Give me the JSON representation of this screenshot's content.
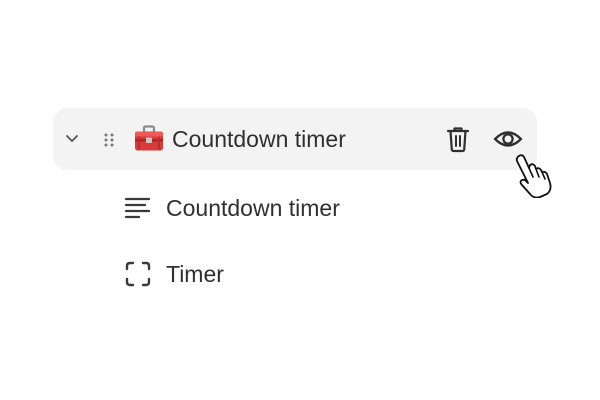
{
  "tree": {
    "parent": {
      "label": "Countdown timer",
      "icons": {
        "expand": "chevron-down-icon",
        "drag": "drag-handle-icon",
        "block": "toolbox-icon",
        "delete": "trash-icon",
        "visibility": "eye-icon"
      }
    },
    "children": [
      {
        "label": "Countdown timer",
        "icon": "text-align-left-icon"
      },
      {
        "label": "Timer",
        "icon": "dashed-frame-icon"
      }
    ]
  },
  "cursor": {
    "icon": "pointer-hand-icon"
  },
  "colors": {
    "row_highlight": "#f3f3f3",
    "text": "#303030",
    "icon": "#3a3a3a",
    "toolbox_red": "#d93a3a"
  }
}
